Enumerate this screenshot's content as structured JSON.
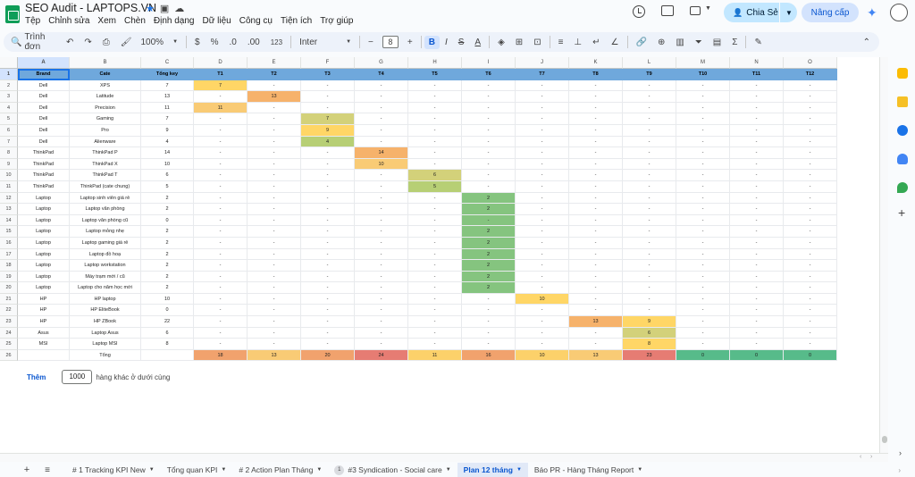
{
  "doc": {
    "title": "SEO Audit - LAPTOPS.VN",
    "menu": [
      "Tệp",
      "Chỉnh sửa",
      "Xem",
      "Chèn",
      "Định dạng",
      "Dữ liệu",
      "Công cụ",
      "Tiện ích",
      "Trợ giúp"
    ]
  },
  "header": {
    "share_label": "Chia Sẻ",
    "upgrade_label": "Nâng cấp"
  },
  "toolbar": {
    "search_placeholder": "Trình đơn",
    "zoom": "100%",
    "currency": "$",
    "percent": "%",
    "decimal_dec": ".0",
    "decimal_inc": ".00",
    "number_format": "123",
    "font": "Inter",
    "font_size": "8",
    "bold": "B",
    "italic": "I",
    "strike": "S",
    "text_color": "A"
  },
  "grid": {
    "columns": [
      "A",
      "B",
      "C",
      "D",
      "E",
      "F",
      "G",
      "H",
      "I",
      "J",
      "K",
      "L",
      "M",
      "N",
      "O"
    ],
    "column_widths": [
      58,
      80,
      59,
      60,
      60,
      60,
      60,
      60,
      60,
      60,
      60,
      60,
      60,
      60,
      60
    ],
    "header_row": [
      "Brand",
      "Cate",
      "Tổng key",
      "T1",
      "T2",
      "T3",
      "T4",
      "T5",
      "T6",
      "T7",
      "T8",
      "T9",
      "T10",
      "T11",
      "T12"
    ],
    "rows": [
      [
        "Dell",
        "XPS",
        "7",
        "7",
        "-",
        "-",
        "-",
        "-",
        "-",
        "-",
        "-",
        "-",
        "-",
        "-",
        "-"
      ],
      [
        "Dell",
        "Latitude",
        "13",
        "-",
        "13",
        "-",
        "-",
        "-",
        "-",
        "-",
        "-",
        "-",
        "-",
        "-",
        "-"
      ],
      [
        "Dell",
        "Precision",
        "11",
        "11",
        "-",
        "-",
        "-",
        "-",
        "-",
        "-",
        "-",
        "-",
        "-",
        "-",
        "-"
      ],
      [
        "Dell",
        "Gaming",
        "7",
        "-",
        "-",
        "7",
        "-",
        "-",
        "-",
        "-",
        "-",
        "-",
        "-",
        "-",
        "-"
      ],
      [
        "Dell",
        "Pro",
        "9",
        "-",
        "-",
        "9",
        "-",
        "-",
        "-",
        "-",
        "-",
        "-",
        "-",
        "-",
        "-"
      ],
      [
        "Dell",
        "Alienware",
        "4",
        "-",
        "-",
        "4",
        "-",
        "-",
        "-",
        "-",
        "-",
        "-",
        "-",
        "-",
        "-"
      ],
      [
        "ThinkPad",
        "ThinkPad P",
        "14",
        "-",
        "-",
        "-",
        "14",
        "-",
        "-",
        "-",
        "-",
        "-",
        "-",
        "-",
        "-"
      ],
      [
        "ThinkPad",
        "ThinkPad X",
        "10",
        "-",
        "-",
        "-",
        "10",
        "-",
        "-",
        "-",
        "-",
        "-",
        "-",
        "-",
        "-"
      ],
      [
        "ThinkPad",
        "ThinkPad T",
        "6",
        "-",
        "-",
        "-",
        "-",
        "6",
        "-",
        "-",
        "-",
        "-",
        "-",
        "-",
        "-"
      ],
      [
        "ThinkPad",
        "ThinkPad (cate chung)",
        "5",
        "-",
        "-",
        "-",
        "-",
        "5",
        "-",
        "-",
        "-",
        "-",
        "-",
        "-",
        "-"
      ],
      [
        "Laptop",
        "Laptop sinh viên giá rẻ",
        "2",
        "-",
        "-",
        "-",
        "-",
        "-",
        "2",
        "-",
        "-",
        "-",
        "-",
        "-",
        "-"
      ],
      [
        "Laptop",
        "Laptop văn phòng",
        "2",
        "-",
        "-",
        "-",
        "-",
        "-",
        "2",
        "-",
        "-",
        "-",
        "-",
        "-",
        "-"
      ],
      [
        "Laptop",
        "Laptop văn phòng cũ",
        "0",
        "-",
        "-",
        "-",
        "-",
        "-",
        "-",
        "-",
        "-",
        "-",
        "-",
        "-",
        "-"
      ],
      [
        "Laptop",
        "Laptop mỏng nhẹ",
        "2",
        "-",
        "-",
        "-",
        "-",
        "-",
        "2",
        "-",
        "-",
        "-",
        "-",
        "-",
        "-"
      ],
      [
        "Laptop",
        "Laptop gaming giá rẻ",
        "2",
        "-",
        "-",
        "-",
        "-",
        "-",
        "2",
        "-",
        "-",
        "-",
        "-",
        "-",
        "-"
      ],
      [
        "Laptop",
        "Laptop đồ hoạ",
        "2",
        "-",
        "-",
        "-",
        "-",
        "-",
        "2",
        "-",
        "-",
        "-",
        "-",
        "-",
        "-"
      ],
      [
        "Laptop",
        "Laptop workstation",
        "2",
        "-",
        "-",
        "-",
        "-",
        "-",
        "2",
        "-",
        "-",
        "-",
        "-",
        "-",
        "-"
      ],
      [
        "Laptop",
        "Máy trạm mới / cũ",
        "2",
        "-",
        "-",
        "-",
        "-",
        "-",
        "2",
        "-",
        "-",
        "-",
        "-",
        "-",
        "-"
      ],
      [
        "Laptop",
        "Laptop cho năm học mới",
        "2",
        "-",
        "-",
        "-",
        "-",
        "-",
        "2",
        "-",
        "-",
        "-",
        "-",
        "-",
        "-"
      ],
      [
        "HP",
        "HP laptop",
        "10",
        "-",
        "-",
        "-",
        "-",
        "-",
        "-",
        "10",
        "-",
        "-",
        "-",
        "-",
        "-"
      ],
      [
        "HP",
        "HP EliteBook",
        "0",
        "-",
        "-",
        "-",
        "-",
        "-",
        "-",
        "-",
        "-",
        "-",
        "-",
        "-",
        "-"
      ],
      [
        "HP",
        "HP ZBook",
        "22",
        "-",
        "-",
        "-",
        "-",
        "-",
        "-",
        "-",
        "13",
        "9",
        "-",
        "-",
        "-"
      ],
      [
        "Asus",
        "Laptop Asus",
        "6",
        "-",
        "-",
        "-",
        "-",
        "-",
        "-",
        "-",
        "-",
        "6",
        "-",
        "-",
        "-"
      ],
      [
        "MSI",
        "Laptop MSI",
        "8",
        "-",
        "-",
        "-",
        "-",
        "-",
        "-",
        "-",
        "-",
        "8",
        "-",
        "-",
        "-"
      ]
    ],
    "total_row": [
      "",
      "Tổng",
      "",
      "18",
      "13",
      "20",
      "24",
      "11",
      "16",
      "10",
      "13",
      "23",
      "0",
      "0",
      "0"
    ],
    "colors": {
      "header_bg": "#6fa8dc",
      "yellow": "#ffd666",
      "orange": "#f6b26b",
      "light_orange": "#f9cb75",
      "olive": "#d3d17a",
      "green_olive": "#b7cf75",
      "green": "#85c47f",
      "total_red": "#e67c73",
      "total_orange": "#f1a26d",
      "total_yellow": "#fcd16a",
      "total_green": "#57bb8a"
    },
    "highlights": [
      {
        "row": 0,
        "col": 3,
        "color": "yellow"
      },
      {
        "row": 1,
        "col": 4,
        "color": "orange"
      },
      {
        "row": 2,
        "col": 3,
        "color": "light_orange"
      },
      {
        "row": 3,
        "col": 5,
        "color": "olive"
      },
      {
        "row": 4,
        "col": 5,
        "color": "yellow"
      },
      {
        "row": 5,
        "col": 5,
        "color": "green_olive"
      },
      {
        "row": 6,
        "col": 6,
        "color": "orange"
      },
      {
        "row": 7,
        "col": 6,
        "color": "light_orange"
      },
      {
        "row": 8,
        "col": 7,
        "color": "olive"
      },
      {
        "row": 9,
        "col": 7,
        "color": "green_olive"
      },
      {
        "row": 10,
        "col": 8,
        "color": "green"
      },
      {
        "row": 11,
        "col": 8,
        "color": "green"
      },
      {
        "row": 12,
        "col": 8,
        "color": "green"
      },
      {
        "row": 13,
        "col": 8,
        "color": "green"
      },
      {
        "row": 14,
        "col": 8,
        "color": "green"
      },
      {
        "row": 15,
        "col": 8,
        "color": "green"
      },
      {
        "row": 16,
        "col": 8,
        "color": "green"
      },
      {
        "row": 17,
        "col": 8,
        "color": "green"
      },
      {
        "row": 18,
        "col": 8,
        "color": "green"
      },
      {
        "row": 19,
        "col": 9,
        "color": "yellow"
      },
      {
        "row": 21,
        "col": 10,
        "color": "orange"
      },
      {
        "row": 21,
        "col": 11,
        "color": "yellow"
      },
      {
        "row": 22,
        "col": 11,
        "color": "olive"
      },
      {
        "row": 23,
        "col": 11,
        "color": "yellow"
      }
    ],
    "total_colors": [
      "",
      "",
      "",
      "total_orange",
      "light_orange",
      "total_orange",
      "total_red",
      "total_yellow",
      "total_orange",
      "total_yellow",
      "light_orange",
      "total_red",
      "total_green",
      "total_green",
      "total_green"
    ]
  },
  "add_rows": {
    "button": "Thêm",
    "count": "1000",
    "suffix": "hàng khác ở dưới cùng"
  },
  "tabs": [
    {
      "label": "# 1 Tracking KPI New",
      "active": false,
      "badge": ""
    },
    {
      "label": "Tổng quan KPI",
      "active": false,
      "badge": ""
    },
    {
      "label": "# 2 Action Plan Tháng",
      "active": false,
      "badge": ""
    },
    {
      "label": "#3 Syndication - Social care",
      "active": false,
      "badge": "1"
    },
    {
      "label": "Plan 12 tháng",
      "active": true,
      "badge": ""
    },
    {
      "label": "Báo PR - Hàng Tháng Report",
      "active": false,
      "badge": ""
    }
  ]
}
